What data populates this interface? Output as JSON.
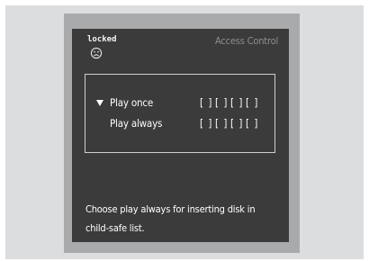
{
  "status": {
    "text": "locked",
    "icon": "sad-face-icon"
  },
  "title": "Access Control",
  "options": [
    {
      "label": "Play once",
      "selected": true,
      "pin_slots": [
        "[ ]",
        "[ ]",
        "[ ]",
        "[ ]"
      ]
    },
    {
      "label": "Play always",
      "selected": false,
      "pin_slots": [
        "[ ]",
        "[ ]",
        "[ ]",
        "[ ]"
      ]
    }
  ],
  "help": {
    "line1": "Choose play always for inserting disk in",
    "line2": "child-safe list."
  },
  "colors": {
    "screen_background": "#3b3b3b",
    "frame": "#a9aaac",
    "outer_background": "#dcdddf",
    "text": "#ffffff",
    "title_text": "#8f8f8f"
  }
}
